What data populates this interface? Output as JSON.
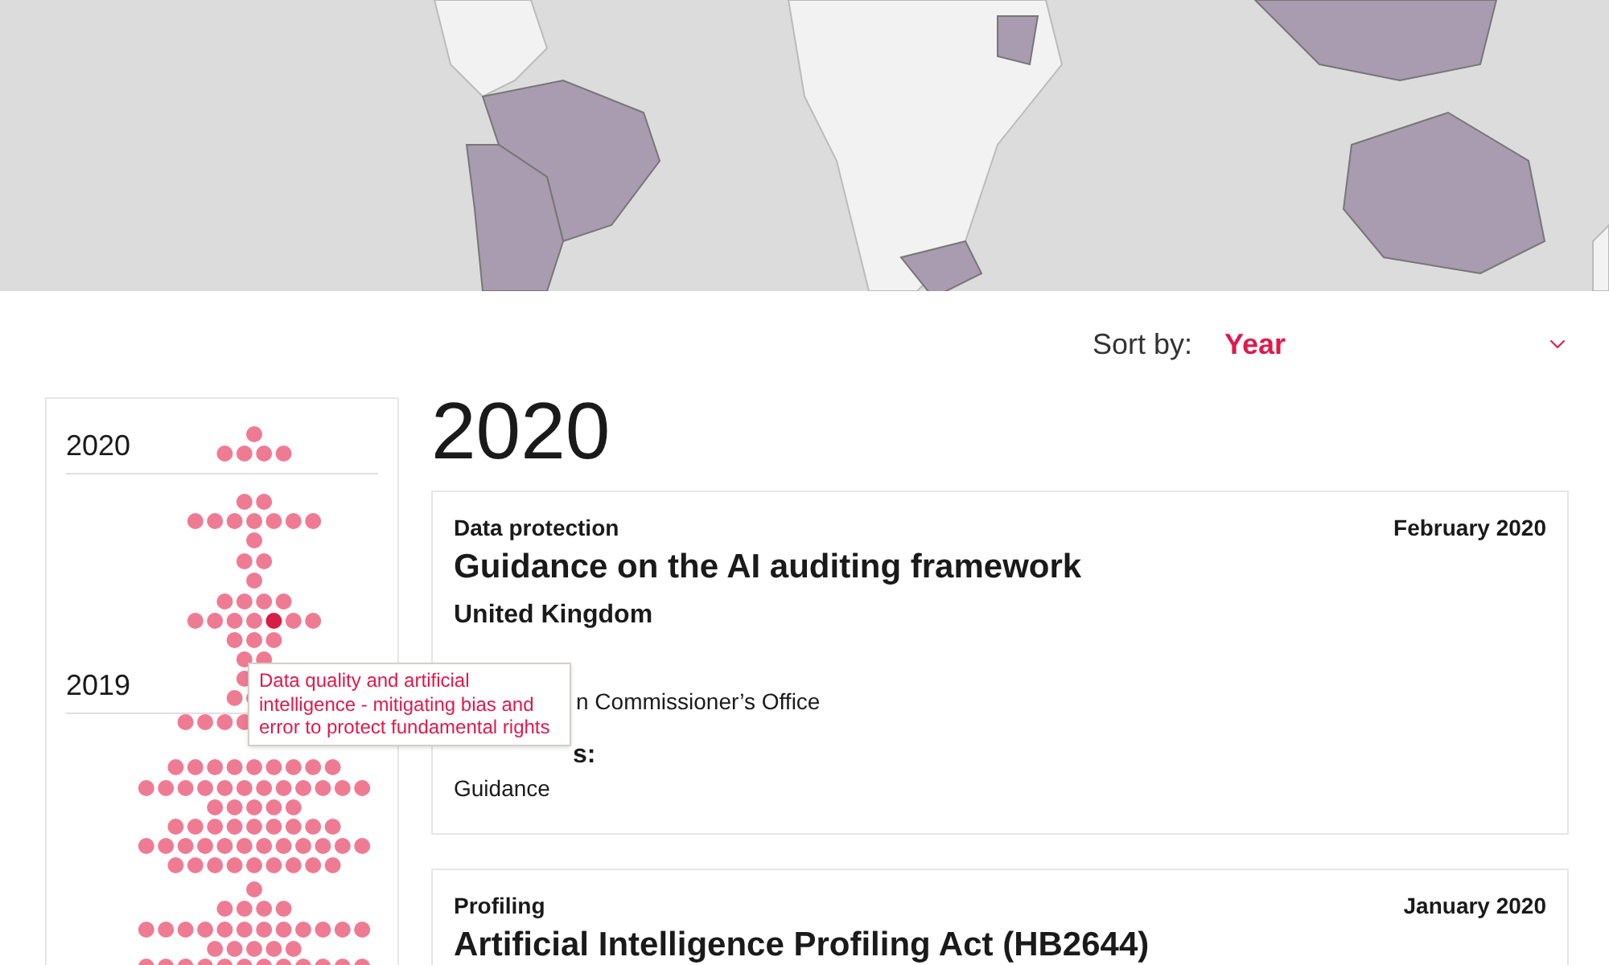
{
  "sort": {
    "label": "Sort by:",
    "value": "Year"
  },
  "timeline": {
    "years": [
      {
        "label": "2020"
      },
      {
        "label": "2019"
      }
    ],
    "tooltip": "Data quality and artificial intelligence - mitigating bias and error to protect fundamental rights"
  },
  "heading": "2020",
  "cards": [
    {
      "category": "Data protection",
      "date": "February 2020",
      "title": "Guidance on the AI auditing framework",
      "country": "United Kingdom",
      "fields": [
        {
          "kind": "value_cut",
          "text": "n Commissioner’s Office"
        },
        {
          "kind": "label_cut",
          "text": "s:"
        },
        {
          "kind": "value",
          "text": "Guidance"
        }
      ]
    },
    {
      "category": "Profiling",
      "date": "January 2020",
      "title": "Artificial Intelligence Profiling Act (HB2644)"
    }
  ]
}
